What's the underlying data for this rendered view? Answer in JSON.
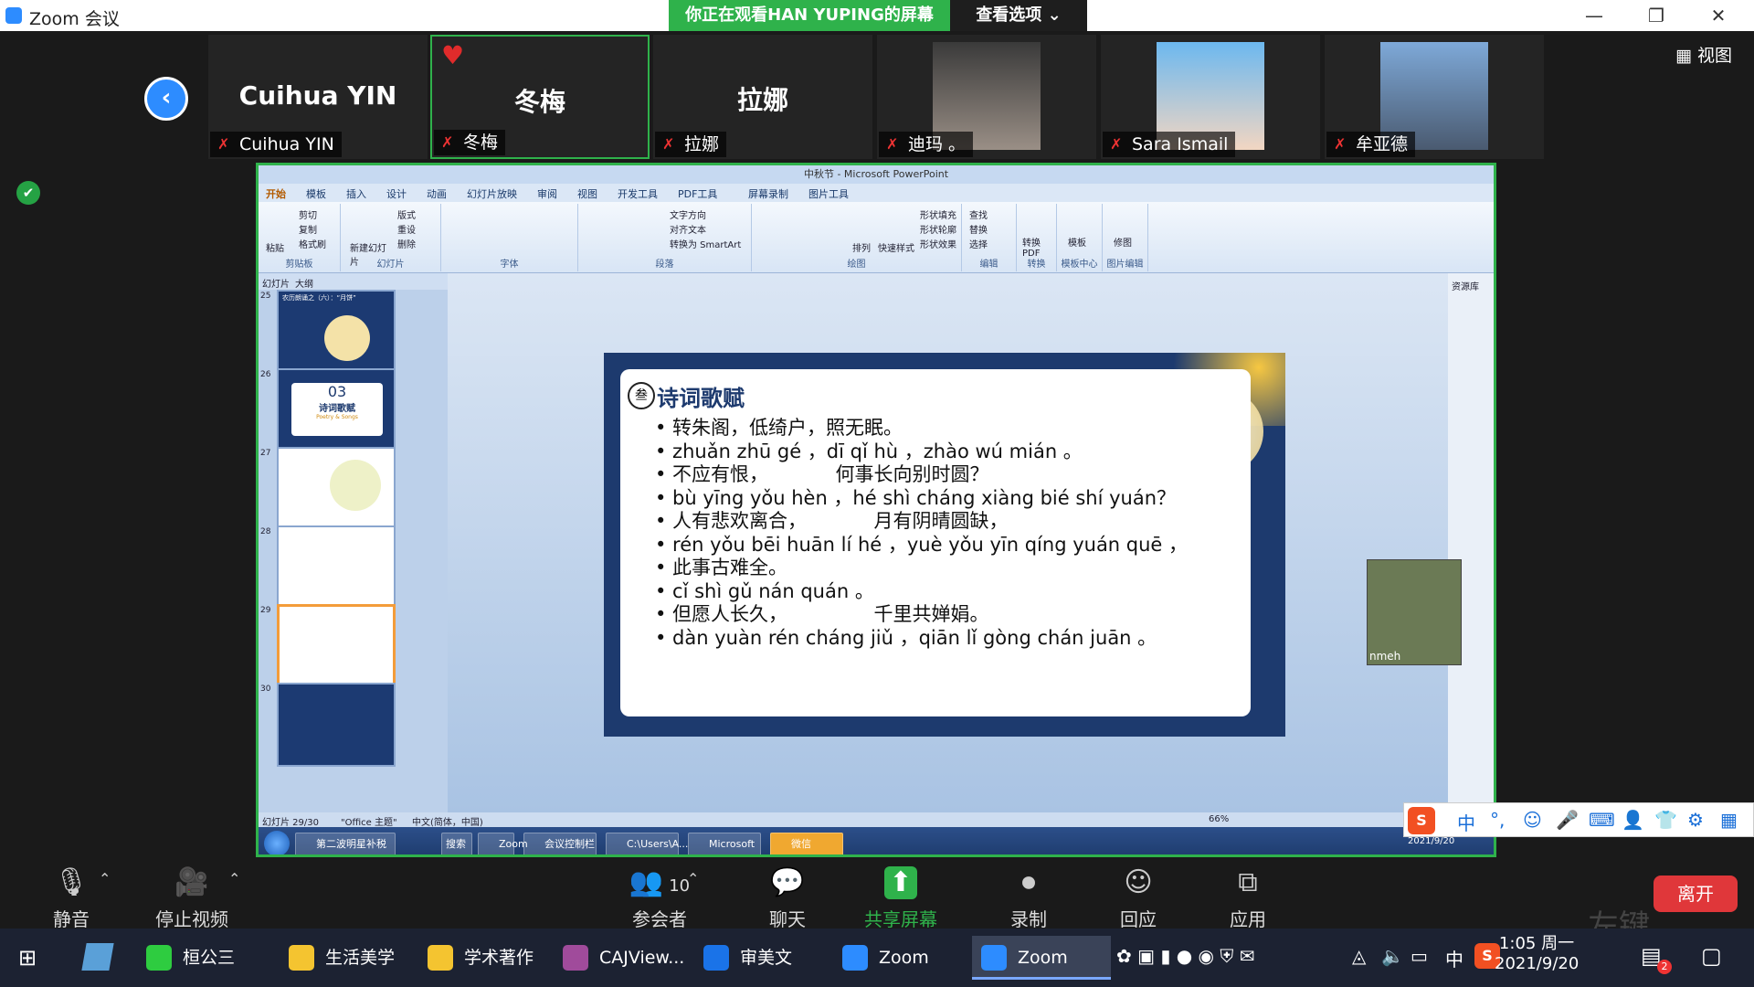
{
  "window": {
    "title": "Zoom 会议",
    "banner": "你正在观看HAN YUPING的屏幕",
    "view_options": "查看选项 ⌄",
    "view_label": "视图"
  },
  "participants": [
    {
      "name": "Cuihua YIN",
      "label": "Cuihua YIN"
    },
    {
      "name": "冬梅",
      "label": "冬梅"
    },
    {
      "name": "拉娜",
      "label": "拉娜"
    },
    {
      "name": "",
      "label": "迪玛 。"
    },
    {
      "name": "",
      "label": "Sara Ismail"
    },
    {
      "name": "",
      "label": "牟亚德"
    }
  ],
  "ppt": {
    "title": "中秋节 - Microsoft PowerPoint",
    "tabs": [
      "开始",
      "模板",
      "插入",
      "设计",
      "动画",
      "幻灯片放映",
      "审阅",
      "视图",
      "开发工具",
      "PDF工具",
      "屏幕录制",
      "图片工具"
    ],
    "groups": [
      "剪贴板",
      "幻灯片",
      "字体",
      "段落",
      "绘图",
      "编辑",
      "转换",
      "模板中心",
      "图片编辑"
    ],
    "clip": [
      "剪切",
      "复制",
      "格式刷",
      "粘贴"
    ],
    "slide_btns": [
      "新建幻灯片",
      "版式",
      "重设",
      "删除"
    ],
    "para_btns": [
      "文字方向",
      "对齐文本",
      "转换为 SmartArt"
    ],
    "draw_btns": [
      "排列",
      "快速样式",
      "形状填充",
      "形状轮廓",
      "形状效果"
    ],
    "edit_btns": [
      "查找",
      "替换",
      "选择"
    ],
    "convert_btn": "转换 PDF",
    "template_btn": "模板",
    "image_btn": "修图",
    "pane_tabs": [
      "幻灯片",
      "大纲"
    ],
    "thumb_nums": [
      "25",
      "26",
      "27",
      "28",
      "29",
      "30"
    ],
    "thumb26": {
      "num": "03",
      "title": "诗词歌赋",
      "sub": "Poetry & Songs"
    },
    "thumb25_title": "农历朗诵之（六）：“月饼”",
    "right_pane_title": "资源库",
    "status": [
      "幻灯片 29/30",
      "\"Office 主题\"",
      "中文(简体，中国)"
    ],
    "zoom_level": "66%"
  },
  "slide": {
    "title": "诗词歌赋",
    "icon": "叁",
    "lines": [
      "• 转朱阁，低绮户，照无眠。",
      "• zhuǎn zhū gé ，dī qǐ hù ，zhào wú mián 。",
      "• 不应有恨，　　　　何事长向别时圆？",
      "• bù yīng yǒu hèn ，hé shì cháng xiàng bié shí yuán？",
      "• 人有悲欢离合，　　　　月有阴晴圆缺，",
      "• rén yǒu bēi huān lí hé ，yuè yǒu yīn qíng yuán quē ，",
      "• 此事古难全。",
      "• cǐ shì gǔ nán quán 。",
      "• 但愿人长久，　　　　　千里共婵娟。",
      "• dàn yuàn rén cháng jiǔ ，qiān lǐ gòng chán juān 。"
    ]
  },
  "self_view_label": "nmeh",
  "inner_taskbar": [
    "第二波明星补税潮",
    "搜索一下",
    "Zoom",
    "会议控制栏",
    "C:\\Users\\A...",
    "Microsoft P...",
    "微信"
  ],
  "inner_clock": "2021/9/20",
  "toolbar": [
    {
      "label": "静音",
      "icon": "mic-icon"
    },
    {
      "label": "停止视频",
      "icon": "video-icon"
    },
    {
      "label": "参会者",
      "icon": "participants-icon",
      "count": "10"
    },
    {
      "label": "聊天",
      "icon": "chat-icon"
    },
    {
      "label": "共享屏幕",
      "icon": "share-icon"
    },
    {
      "label": "录制",
      "icon": "record-icon"
    },
    {
      "label": "回应",
      "icon": "reaction-icon"
    },
    {
      "label": "应用",
      "icon": "apps-icon"
    }
  ],
  "leave_label": "离开",
  "watermark": "左键",
  "ime": [
    "中",
    "°,",
    "☺",
    "🎤",
    "⌨",
    "👤",
    "👕",
    "⚙",
    "▦"
  ],
  "taskbar": [
    {
      "label": "桓公三年...",
      "color": "#2ecc40"
    },
    {
      "label": "生活美学",
      "color": "#f4c430"
    },
    {
      "label": "学术著作",
      "color": "#f4c430"
    },
    {
      "label": "CAJView...",
      "color": "#a04b9b"
    },
    {
      "label": "审美文化...",
      "color": "#1a73e8"
    },
    {
      "label": "Zoom",
      "color": "#2d8cff"
    },
    {
      "label": "Zoom 会...",
      "color": "#2d8cff"
    }
  ],
  "clock": {
    "time": "1:05 周一",
    "date": "2021/9/20"
  },
  "tray_ime": "中",
  "notif_count": "2",
  "colors": {
    "zoom_blue": "#2d8cff",
    "share_green": "#2fb24b",
    "leave_red": "#e0373a"
  }
}
